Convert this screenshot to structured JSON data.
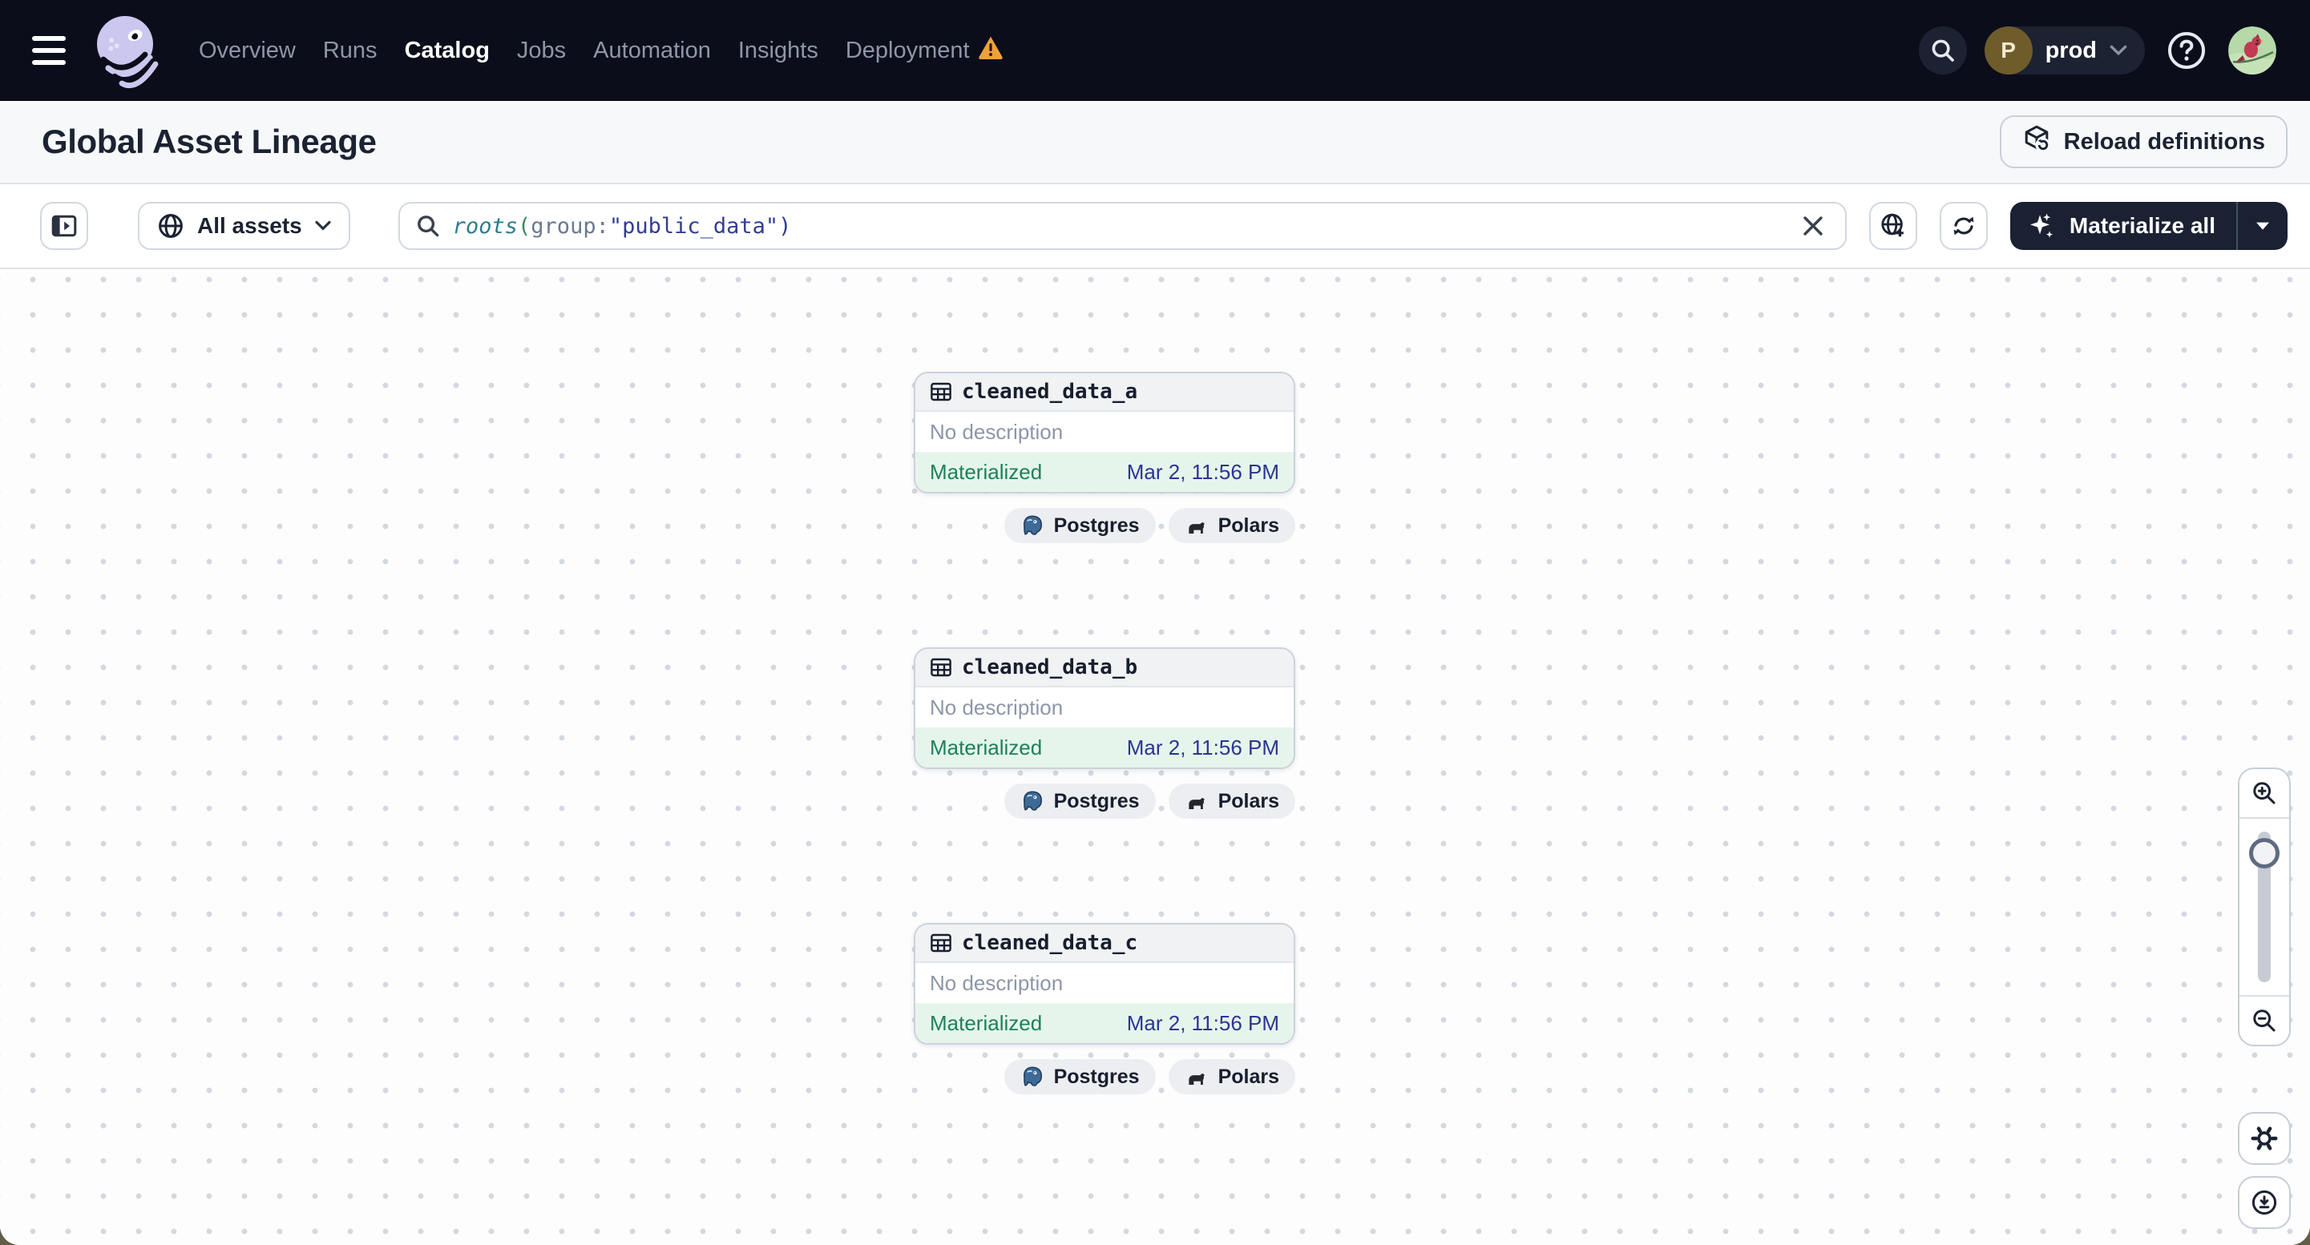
{
  "nav": {
    "links": [
      {
        "label": "Overview",
        "active": false
      },
      {
        "label": "Runs",
        "active": false
      },
      {
        "label": "Catalog",
        "active": true
      },
      {
        "label": "Jobs",
        "active": false
      },
      {
        "label": "Automation",
        "active": false
      },
      {
        "label": "Insights",
        "active": false
      },
      {
        "label": "Deployment",
        "active": false,
        "warning": true
      }
    ],
    "environment": {
      "initial": "P",
      "name": "prod"
    }
  },
  "header": {
    "title": "Global Asset Lineage",
    "reload_button": "Reload definitions"
  },
  "toolbar": {
    "scope": {
      "label": "All assets"
    },
    "search": {
      "value": "roots(group:\"public_data\")",
      "tokens": [
        {
          "text": "roots",
          "style": "function"
        },
        {
          "text": "(",
          "style": "paren-open"
        },
        {
          "text": "group",
          "style": "key"
        },
        {
          "text": ":",
          "style": "colon"
        },
        {
          "text": "\"public_data\"",
          "style": "string"
        },
        {
          "text": ")",
          "style": "paren-close"
        }
      ]
    },
    "materialize": {
      "label": "Materialize all"
    }
  },
  "graph": {
    "nodes": [
      {
        "name": "cleaned_data_a",
        "description": "No description",
        "status": "Materialized",
        "timestamp": "Mar 2, 11:56 PM",
        "tags": [
          {
            "label": "Postgres"
          },
          {
            "label": "Polars"
          }
        ]
      },
      {
        "name": "cleaned_data_b",
        "description": "No description",
        "status": "Materialized",
        "timestamp": "Mar 2, 11:56 PM",
        "tags": [
          {
            "label": "Postgres"
          },
          {
            "label": "Polars"
          }
        ]
      },
      {
        "name": "cleaned_data_c",
        "description": "No description",
        "status": "Materialized",
        "timestamp": "Mar 2, 11:56 PM",
        "tags": [
          {
            "label": "Postgres"
          },
          {
            "label": "Polars"
          }
        ]
      }
    ]
  },
  "colors": {
    "nav_background": "#0b0d1a",
    "nav_link": "#8e96a8",
    "nav_link_active": "#ffffff",
    "warning": "#efa13a",
    "brand_lavender": "#cbc7ee",
    "title_bar": "#f7f8f9",
    "accent_dark": "#1a2133",
    "materialized_bg": "#e6f5ec",
    "materialized_text": "#1e8159",
    "timestamp_text": "#2c3590",
    "query_function": "#2e7d8c",
    "query_string": "#333d8f",
    "postgres_blue": "#3d6a96",
    "env_avatar": "#6f5c2b"
  }
}
